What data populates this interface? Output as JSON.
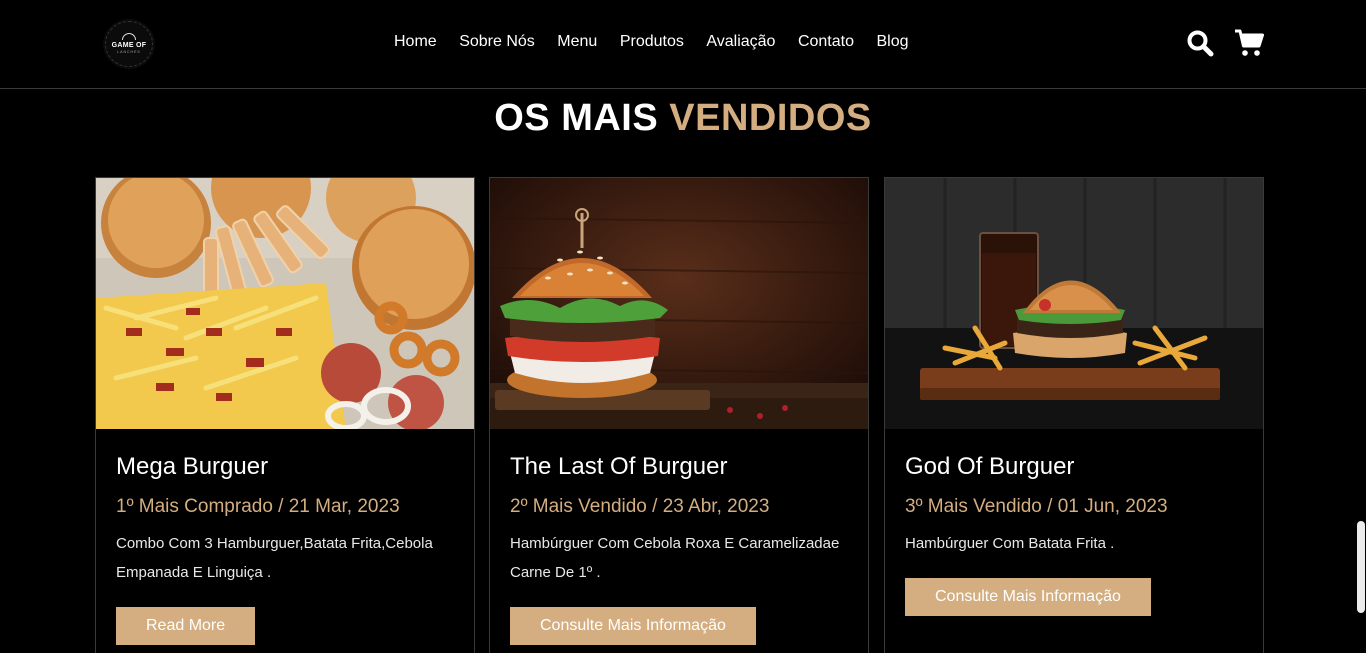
{
  "brand": {
    "logo_line1": "GAME OF",
    "logo_line2": "LANCHES"
  },
  "nav": {
    "items": [
      "Home",
      "Sobre Nós",
      "Menu",
      "Produtos",
      "Avaliação",
      "Contato",
      "Blog"
    ]
  },
  "header_icons": {
    "search": "search-icon",
    "cart": "cart-icon"
  },
  "section": {
    "title_white": "OS MAIS",
    "title_accent": "VENDIDOS"
  },
  "colors": {
    "accent": "#d4ae80",
    "background": "#000000",
    "border": "#3a3a3a"
  },
  "cards": [
    {
      "title": "Mega Burguer",
      "meta": "1º Mais Comprado / 21 Mar, 2023",
      "description": "Combo Com 3 Hamburguer,Batata Frita,Cebola Empanada E Linguiça .",
      "button": "Read More"
    },
    {
      "title": "The Last Of Burguer",
      "meta": "2º Mais Vendido / 23 Abr, 2023",
      "description": "Hambúrguer Com Cebola Roxa E Caramelizadae Carne De 1º .",
      "button": "Consulte Mais Informação"
    },
    {
      "title": "God Of Burguer",
      "meta": "3º Mais Vendido / 01 Jun, 2023",
      "description": "Hambúrguer Com Batata Frita .",
      "button": "Consulte Mais Informação"
    }
  ]
}
